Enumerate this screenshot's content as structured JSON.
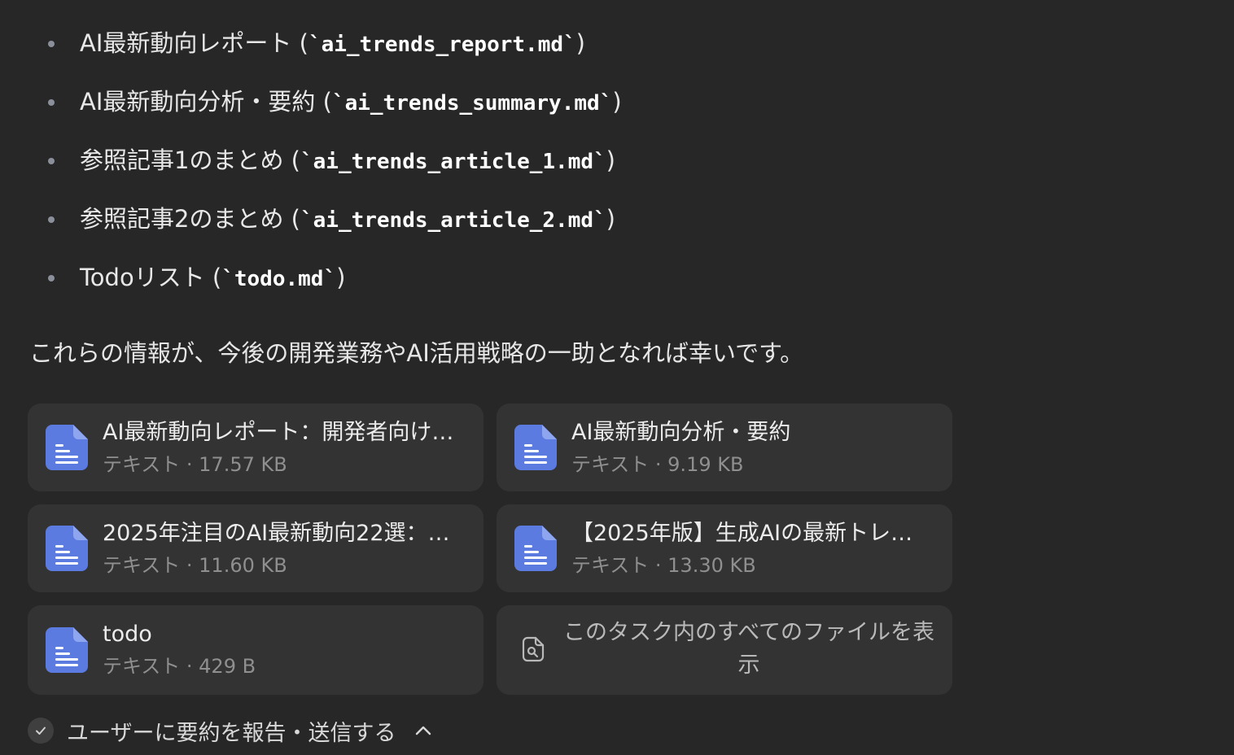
{
  "bullets": [
    {
      "text": "AI最新動向レポート (",
      "code": "`ai_trends_report.md`",
      "close": ")"
    },
    {
      "text": "AI最新動向分析・要約 (",
      "code": "`ai_trends_summary.md`",
      "close": ")"
    },
    {
      "text": "参照記事1のまとめ (",
      "code": "`ai_trends_article_1.md`",
      "close": ")"
    },
    {
      "text": "参照記事2のまとめ (",
      "code": "`ai_trends_article_2.md`",
      "close": ")"
    },
    {
      "text": "Todoリスト (",
      "code": "`todo.md`",
      "close": ")"
    }
  ],
  "closing_text": "これらの情報が、今後の開発業務やAI活用戦略の一助となれば幸いです。",
  "files": [
    {
      "title": "AI最新動向レポート：開発者向け…",
      "meta": "テキスト · 17.57 KB",
      "icon": "document-icon"
    },
    {
      "title": "AI最新動向分析・要約",
      "meta": "テキスト · 9.19 KB",
      "icon": "document-icon"
    },
    {
      "title": "2025年注目のAI最新動向22選：…",
      "meta": "テキスト · 11.60 KB",
      "icon": "document-icon"
    },
    {
      "title": "【2025年版】生成AIの最新トレ…",
      "meta": "テキスト · 13.30 KB",
      "icon": "document-icon"
    },
    {
      "title": "todo",
      "meta": "テキスト · 429 B",
      "icon": "document-icon"
    }
  ],
  "view_all": {
    "label": "このタスク内のすべてのファイルを表示",
    "icon": "file-search-icon"
  },
  "status": {
    "label": "ユーザーに要約を報告・送信する",
    "icon": "check-icon",
    "toggle_icon": "chevron-up-icon"
  },
  "colors": {
    "background": "#272727",
    "card": "#333333",
    "doc_icon": "#5b7be0",
    "muted_text": "#8f8f8f"
  }
}
